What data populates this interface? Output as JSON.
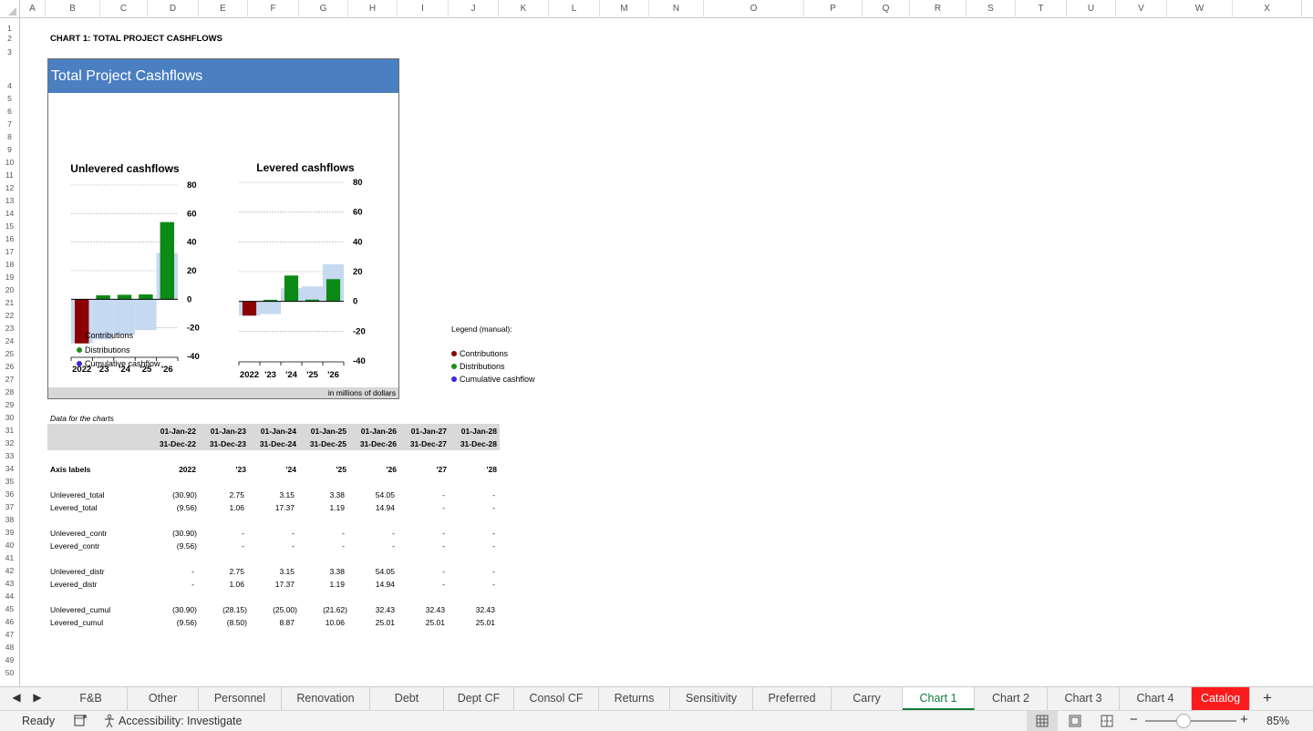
{
  "column_headers": [
    "A",
    "B",
    "C",
    "D",
    "E",
    "F",
    "G",
    "H",
    "I",
    "J",
    "K",
    "L",
    "M",
    "N",
    "O",
    "P",
    "Q",
    "R",
    "S",
    "T",
    "U",
    "V",
    "W",
    "X"
  ],
  "row_headers": [
    "1",
    "2",
    "3",
    "4",
    "5",
    "6",
    "7",
    "8",
    "9",
    "10",
    "11",
    "12",
    "13",
    "14",
    "15",
    "16",
    "17",
    "18",
    "19",
    "20",
    "21",
    "22",
    "23",
    "24",
    "25",
    "26",
    "27",
    "28",
    "29",
    "30",
    "31",
    "32",
    "33",
    "34",
    "35",
    "36",
    "37",
    "38",
    "39",
    "40",
    "41",
    "42",
    "43",
    "44",
    "45",
    "46",
    "47",
    "48",
    "49",
    "50"
  ],
  "sheet_title": "CHART 1: TOTAL PROJECT CASHFLOWS",
  "chart_card": {
    "header": "Total Project Cashflows",
    "footer": "in millions of dollars",
    "legend": [
      {
        "label": "Contributions",
        "color": "#8b0000"
      },
      {
        "label": "Distributions",
        "color": "#1a8f1a"
      },
      {
        "label": "Cumulative cashflow",
        "color": "#3b28e0"
      }
    ]
  },
  "chart_data": [
    {
      "type": "bar",
      "title": "Unlevered cashflows",
      "categories": [
        "2022",
        "'23",
        "'24",
        "'25",
        "'26"
      ],
      "ylim": [
        -40,
        80
      ],
      "yticks": [
        "80",
        "60",
        "40",
        "20",
        "0",
        "-20",
        "-40"
      ],
      "yticks_num": [
        80,
        60,
        40,
        20,
        0,
        -20,
        -40
      ],
      "series": [
        {
          "name": "Contributions",
          "color": "#8b0000",
          "values": [
            -30.9,
            0,
            0,
            0,
            0
          ]
        },
        {
          "name": "Distributions",
          "color": "#0c8a16",
          "values": [
            0,
            2.75,
            3.15,
            3.38,
            54.05
          ]
        },
        {
          "name": "Cumulative cashflow",
          "color": "#c5d9f1",
          "values": [
            -30.9,
            -28.15,
            -25.0,
            -21.62,
            32.43
          ]
        }
      ]
    },
    {
      "type": "bar",
      "title": "Levered cashflows",
      "categories": [
        "2022",
        "'23",
        "'24",
        "'25",
        "'26"
      ],
      "ylim": [
        -40,
        80
      ],
      "yticks": [
        "80",
        "60",
        "40",
        "20",
        "0",
        "-20",
        "-40"
      ],
      "yticks_num": [
        80,
        60,
        40,
        20,
        0,
        -20,
        -40
      ],
      "series": [
        {
          "name": "Contributions",
          "color": "#8b0000",
          "values": [
            -9.56,
            0,
            0,
            0,
            0
          ]
        },
        {
          "name": "Distributions",
          "color": "#0c8a16",
          "values": [
            0,
            1.06,
            17.37,
            1.19,
            14.94
          ]
        },
        {
          "name": "Cumulative cashflow",
          "color": "#c5d9f1",
          "values": [
            -9.56,
            -8.5,
            8.87,
            10.06,
            25.01
          ]
        }
      ]
    }
  ],
  "manual_legend": {
    "title": "Legend (manual):",
    "items": [
      {
        "label": "Contributions",
        "color": "#8b0000"
      },
      {
        "label": "Distributions",
        "color": "#1a8f1a"
      },
      {
        "label": "Cumulative cashflow",
        "color": "#3b28e0"
      }
    ]
  },
  "data_table": {
    "caption": "Data for the charts",
    "start_dates": [
      "01-Jan-22",
      "01-Jan-23",
      "01-Jan-24",
      "01-Jan-25",
      "01-Jan-26",
      "01-Jan-27",
      "01-Jan-28"
    ],
    "end_dates": [
      "31-Dec-22",
      "31-Dec-23",
      "31-Dec-24",
      "31-Dec-25",
      "31-Dec-26",
      "31-Dec-27",
      "31-Dec-28"
    ],
    "axis_label_row": {
      "label": "Axis labels",
      "values": [
        "2022",
        "'23",
        "'24",
        "'25",
        "'26",
        "'27",
        "'28"
      ]
    },
    "rows": [
      {
        "label": "Unlevered_total",
        "values": [
          "(30.90)",
          "2.75",
          "3.15",
          "3.38",
          "54.05",
          "-",
          "-"
        ]
      },
      {
        "label": "Levered_total",
        "values": [
          "(9.56)",
          "1.06",
          "17.37",
          "1.19",
          "14.94",
          "-",
          "-"
        ]
      },
      {
        "label": "Unlevered_contr",
        "values": [
          "(30.90)",
          "-",
          "-",
          "-",
          "-",
          "-",
          "-"
        ]
      },
      {
        "label": "Levered_contr",
        "values": [
          "(9.56)",
          "-",
          "-",
          "-",
          "-",
          "-",
          "-"
        ]
      },
      {
        "label": "Unlevered_distr",
        "values": [
          "-",
          "2.75",
          "3.15",
          "3.38",
          "54.05",
          "-",
          "-"
        ]
      },
      {
        "label": "Levered_distr",
        "values": [
          "-",
          "1.06",
          "17.37",
          "1.19",
          "14.94",
          "-",
          "-"
        ]
      },
      {
        "label": "Unlevered_cumul",
        "values": [
          "(30.90)",
          "(28.15)",
          "(25.00)",
          "(21.62)",
          "32.43",
          "32.43",
          "32.43"
        ]
      },
      {
        "label": "Levered_cumul",
        "values": [
          "(9.56)",
          "(8.50)",
          "8.87",
          "10.06",
          "25.01",
          "25.01",
          "25.01"
        ]
      }
    ]
  },
  "sheet_tabs": [
    "F&B",
    "Other",
    "Personnel",
    "Renovation",
    "Debt",
    "Dept CF",
    "Consol CF",
    "Returns",
    "Sensitivity",
    "Preferred",
    "Carry",
    "Chart 1",
    "Chart 2",
    "Chart 3",
    "Chart 4",
    "Catalog"
  ],
  "active_tab": "Chart 1",
  "status_bar": {
    "ready": "Ready",
    "accessibility": "Accessibility: Investigate",
    "zoom": "85%"
  },
  "icons": {
    "nav_prev": "◀",
    "nav_next": "▶",
    "add_sheet": "+",
    "zoom_out": "−",
    "zoom_in": "+"
  }
}
